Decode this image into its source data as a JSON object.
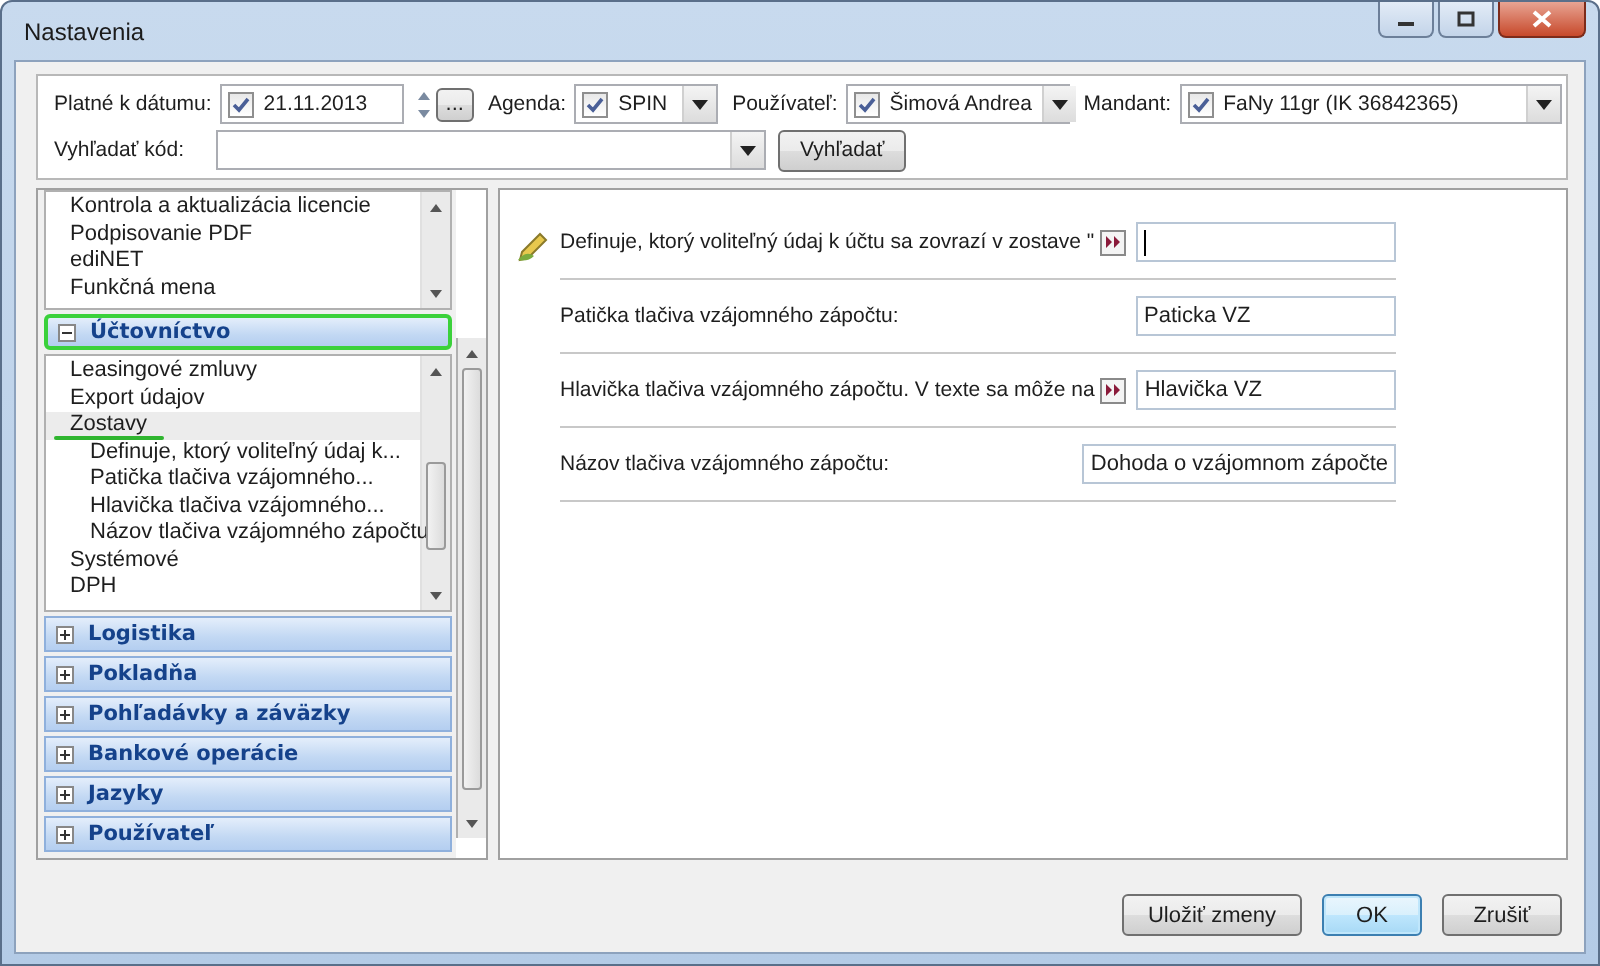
{
  "window": {
    "title": "Nastavenia"
  },
  "filters": [
    {
      "kind": "date",
      "label": "Platné k dátumu:",
      "checked": true,
      "value": "21.11.2013",
      "button": "..."
    },
    {
      "kind": "combo",
      "label": "Agenda:",
      "checked": true,
      "value": "SPIN"
    },
    {
      "kind": "combo",
      "label": "Používateľ:",
      "checked": true,
      "value": "Šimová Andrea"
    },
    {
      "kind": "combo",
      "label": "Mandant:",
      "checked": true,
      "value": "FaNy 11gr (IK 36842365)"
    }
  ],
  "search": {
    "label": "Vyhľadať kód:",
    "button": "Vyhľadať"
  },
  "sidebar": {
    "list": [
      {
        "label": "Kontrola a aktualizácia licencie",
        "selected": false
      },
      {
        "label": "Podpisovanie PDF",
        "selected": false
      },
      {
        "label": "ediNET",
        "selected": false
      },
      {
        "label": "Funkčná mena",
        "selected": false
      }
    ],
    "sections": [
      {
        "title": "Účtovníctvo",
        "expanded": true,
        "highlighted": true,
        "items": [
          {
            "label": "Leasingové zmluvy",
            "selected": false,
            "underlined": false
          },
          {
            "label": "Export údajov",
            "selected": false,
            "underlined": false
          },
          {
            "label": "Zostavy",
            "selected": true,
            "underlined": true,
            "children": [
              {
                "label": "Definuje, ktorý voliteľný údaj k...",
                "selected": false,
                "underlined": false
              },
              {
                "label": "Patička tlačiva vzájomného...",
                "selected": false,
                "underlined": false
              },
              {
                "label": "Hlavička tlačiva vzájomného...",
                "selected": false,
                "underlined": false
              },
              {
                "label": "Názov tlačiva vzájomného zápočtu",
                "selected": false,
                "underlined": false
              }
            ]
          },
          {
            "label": "Systémové",
            "selected": false,
            "underlined": false
          },
          {
            "label": "DPH",
            "selected": false,
            "underlined": false
          }
        ]
      },
      {
        "title": "Logistika",
        "expanded": false,
        "highlighted": false
      },
      {
        "title": "Pokladňa",
        "expanded": false,
        "highlighted": false
      },
      {
        "title": "Pohľadávky a záväzky",
        "expanded": false,
        "highlighted": false
      },
      {
        "title": "Bankové operácie",
        "expanded": false,
        "highlighted": false
      },
      {
        "title": "Jazyky",
        "expanded": false,
        "highlighted": false
      },
      {
        "title": "Používateľ",
        "expanded": false,
        "highlighted": false
      }
    ]
  },
  "settings": [
    {
      "label": "Definuje, ktorý voliteľný údaj k účtu sa zovrazí v zostave \"",
      "kind": "expandable",
      "editing": true
    },
    {
      "label": "Patička tlačiva vzájomného zápočtu:",
      "kind": "plain",
      "editing": false,
      "value": "Paticka VZ"
    },
    {
      "label": "Hlavička tlačiva vzájomného zápočtu. V texte sa môže na",
      "kind": "expandable",
      "editing": false,
      "value": "Hlavička VZ"
    },
    {
      "label": "Názov tlačiva vzájomného zápočtu:",
      "kind": "plain",
      "editing": false,
      "value": "Dohoda o vzájomnom zápočte"
    }
  ],
  "buttons": [
    {
      "label": "Uložiť zmeny",
      "focused": false
    },
    {
      "label": "OK",
      "focused": true
    },
    {
      "label": "Zrušiť",
      "focused": false
    }
  ]
}
